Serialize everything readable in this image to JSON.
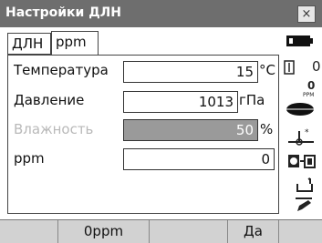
{
  "window": {
    "title": "Настройки ДЛН",
    "close_label": "×"
  },
  "tabs": [
    {
      "label": "ДЛН"
    },
    {
      "label": "ppm"
    }
  ],
  "fields": [
    {
      "label": "Температура",
      "value": "15",
      "unit": "°C",
      "enabled": true
    },
    {
      "label": "Давление",
      "value": "1013",
      "unit": "гПа",
      "enabled": true
    },
    {
      "label": "Влажность",
      "value": "50",
      "unit": "%",
      "enabled": false
    },
    {
      "label": "ppm",
      "value": "0",
      "unit": "",
      "enabled": true
    }
  ],
  "status": {
    "prism_constant": "0",
    "ppm_value": "0",
    "ppm_caption": "PPM"
  },
  "softkeys": [
    {
      "label": ""
    },
    {
      "label": "0ppm"
    },
    {
      "label": ""
    },
    {
      "label": "Да"
    },
    {
      "label": ""
    }
  ],
  "colors": {
    "titlebar": "#6e6e6e",
    "disabled_field": "#9a9a9a",
    "softkey_bar": "#c8c8c8"
  },
  "icons": [
    "battery-icon",
    "prism-icon",
    "ppm-icon",
    "target-type-icon",
    "laser-plummet-icon",
    "instrument-icon",
    "tilt-icon",
    "edit-icon"
  ]
}
